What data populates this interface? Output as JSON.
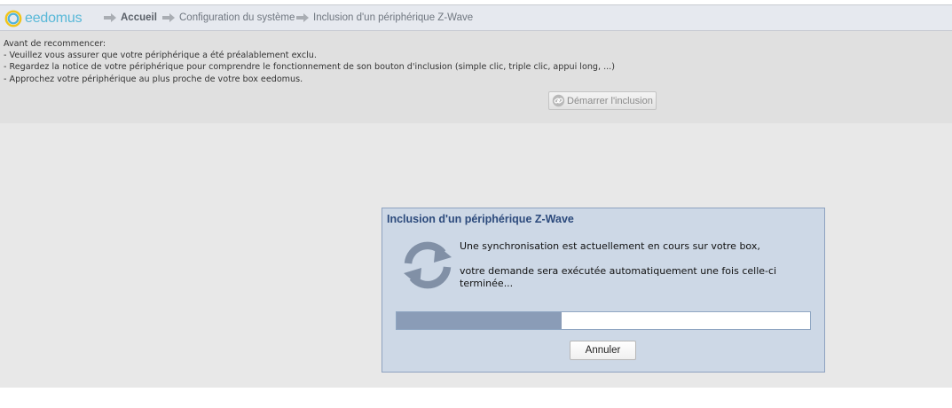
{
  "brand": {
    "name": "eedomus"
  },
  "breadcrumb": {
    "items": [
      {
        "label": "Accueil"
      },
      {
        "label": "Configuration du système"
      },
      {
        "label": "Inclusion d'un périphérique Z-Wave"
      }
    ]
  },
  "instructions": {
    "lines": [
      "Avant de recommencer:",
      "- Veuillez vous assurer que votre périphérique a été préalablement exclu.",
      "- Regardez la notice de votre périphérique pour comprendre le fonctionnement de son bouton d'inclusion (simple clic, triple clic, appui long, ...)",
      "- Approchez votre périphérique au plus proche de votre box eedomus."
    ],
    "start_button": "Démarrer l'inclusion"
  },
  "dialog": {
    "title": "Inclusion d'un périphérique Z-Wave",
    "message_line1": "Une synchronisation est actuellement en cours sur votre box,",
    "message_line2": "votre demande sera exécutée automatiquement une fois celle-ci terminée...",
    "progress_fraction": 0.4,
    "cancel_label": "Annuler"
  },
  "colors": {
    "header_bg": "#e6e9ef",
    "info_bg": "#e0e0e0",
    "main_bg": "#e8e8e8",
    "dialog_bg": "#cdd8e6",
    "dialog_title": "#2c4a7c",
    "progress_fill": "#8a9cb7",
    "brand_text": "#58b8d8"
  },
  "icons": {
    "logo": "eedomus-ring-logo",
    "breadcrumb_separator": "arrow-right-icon",
    "start": "link-icon",
    "sync": "sync-icon"
  }
}
